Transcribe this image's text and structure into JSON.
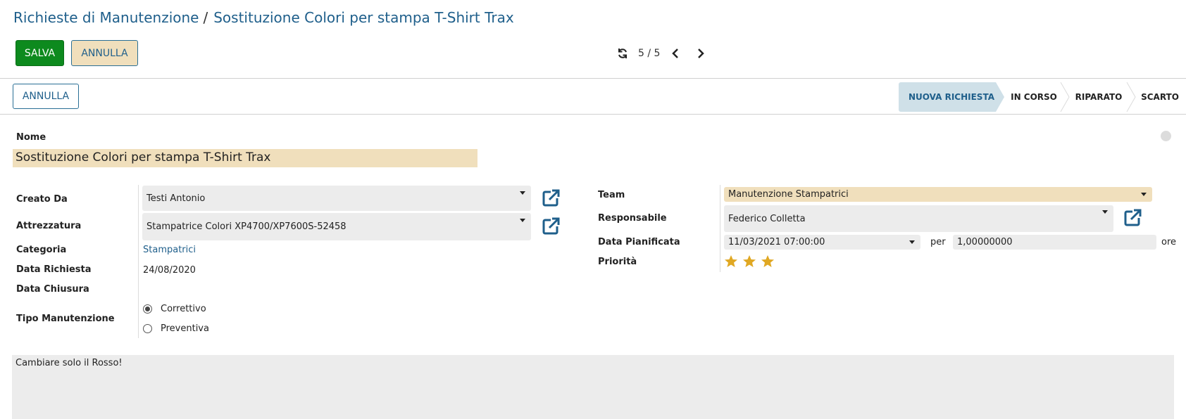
{
  "breadcrumb": {
    "parent": "Richieste di Manutenzione",
    "separator": "/",
    "current": "Sostituzione Colori per stampa T-Shirt Trax"
  },
  "toolbar": {
    "save_label": "SALVA",
    "discard_label": "ANNULLA",
    "pager_text": "5 / 5"
  },
  "statusbar": {
    "cancel_label": "ANNULLA",
    "stages": [
      "NUOVA RICHIESTA",
      "IN CORSO",
      "RIPARATO",
      "SCARTO"
    ],
    "active_stage": "NUOVA RICHIESTA"
  },
  "form": {
    "name_label": "Nome",
    "name_value": "Sostituzione Colori per stampa T-Shirt Trax",
    "left": {
      "created_by_label": "Creato Da",
      "created_by_value": "Testi Antonio",
      "equipment_label": "Attrezzatura",
      "equipment_value": "Stampatrice Colori XP4700/XP7600S-52458",
      "category_label": "Categoria",
      "category_value": "Stampatrici",
      "request_date_label": "Data Richiesta",
      "request_date_value": "24/08/2020",
      "close_date_label": "Data Chiusura",
      "maintenance_type_label": "Tipo Manutenzione",
      "maintenance_options": [
        "Correttivo",
        "Preventiva"
      ],
      "maintenance_selected": "Correttivo"
    },
    "right": {
      "team_label": "Team",
      "team_value": "Manutenzione Stampatrici",
      "responsible_label": "Responsabile",
      "responsible_value": "Federico Colletta",
      "scheduled_label": "Data Pianificata",
      "scheduled_value": "11/03/2021 07:00:00",
      "per_label": "per",
      "duration_value": "1,00000000",
      "hours_label": "ore",
      "priority_label": "Priorità",
      "priority_stars": 3,
      "priority_max": 3
    },
    "notes": "Cambiare solo il Rosso!"
  },
  "colors": {
    "primary": "#1f5f8b",
    "save_button": "#0d8a1e",
    "required_field": "#f0dfbc",
    "active_stage": "#cfe0e8",
    "star": "#e0a823"
  },
  "icons": [
    "refresh-icon",
    "chevron-left-icon",
    "chevron-right-icon",
    "external-link-icon",
    "star-icon",
    "dropdown-caret-icon",
    "status-dot-icon"
  ]
}
